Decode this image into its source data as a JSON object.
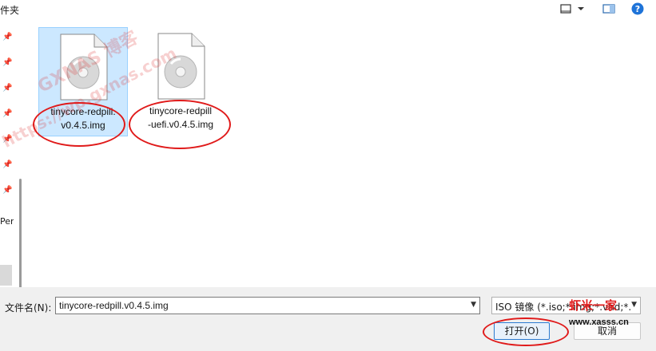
{
  "window": {
    "title": "件夹"
  },
  "toolbar": {
    "view_icon": "view-list-icon",
    "dropdown_icon": "caret-down-icon",
    "preview_icon": "preview-pane-icon",
    "help_label": "?"
  },
  "nav_pane": {
    "pins": [
      "pin-icon",
      "pin-icon",
      "pin-icon",
      "pin-icon",
      "pin-icon",
      "pin-icon",
      "pin-icon"
    ],
    "item_text": "Pers"
  },
  "files": [
    {
      "name": "tinycore-redpill.\nv0.4.5.img",
      "selected": true,
      "icon": "disc-image-icon"
    },
    {
      "name": "tinycore-redpill\n-uefi.v0.4.5.img",
      "selected": false,
      "icon": "disc-image-icon"
    }
  ],
  "bottom": {
    "filename_label": "文件名(N):",
    "filename_value": "tinycore-redpill.v0.4.5.img",
    "filetype_value": "ISO 镜像 (*.iso;*.img;*.vhd;*.",
    "open_label": "打开(O)",
    "cancel_label": "取消"
  },
  "watermarks": {
    "top_text": "GXNAS 博客",
    "url_text": "https://wp.gxnas.com",
    "brand_text": "虾米一家",
    "brand_url": "www.xasss.cn"
  },
  "colors": {
    "selection": "#cce8ff",
    "annotation": "#e01a1a",
    "help": "#1e73d8"
  }
}
